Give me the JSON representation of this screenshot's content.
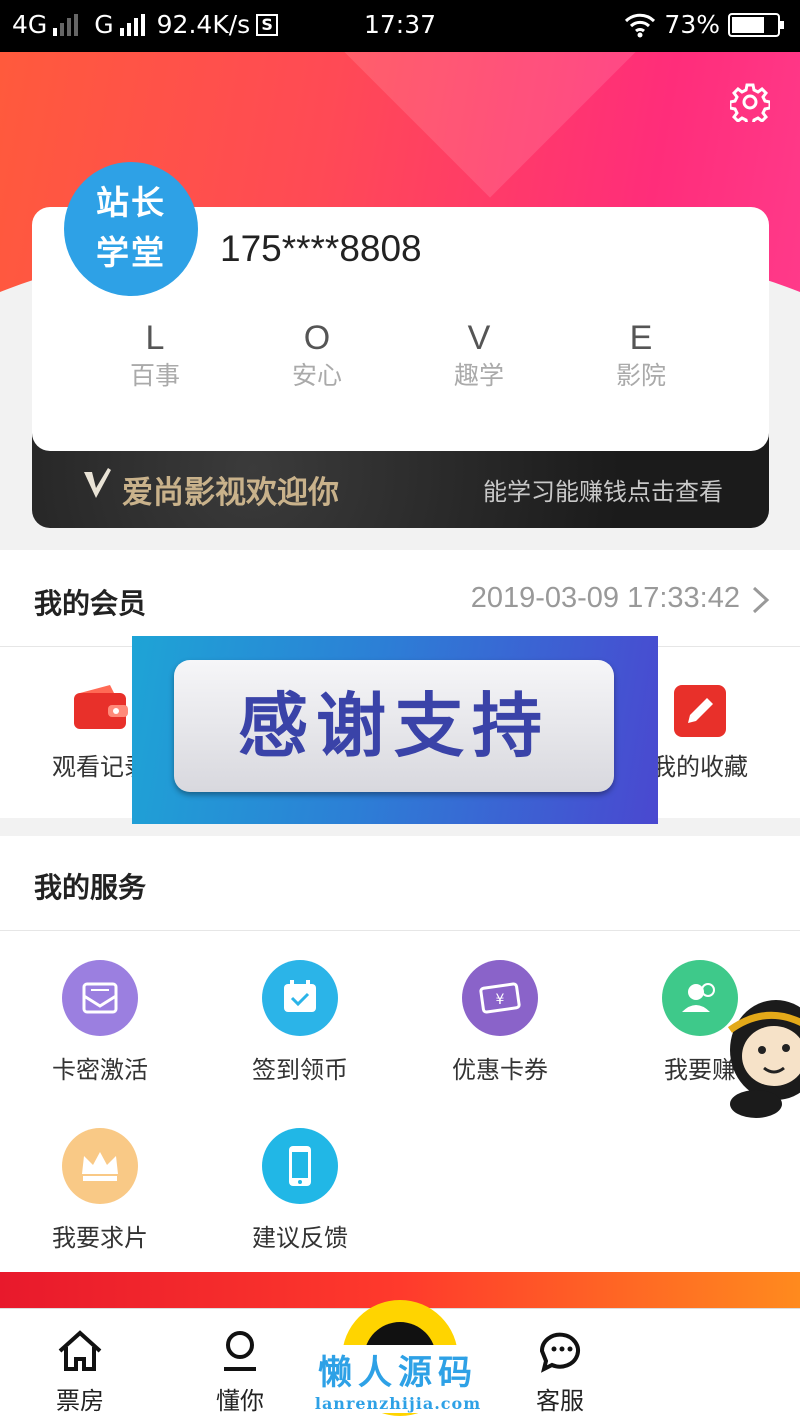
{
  "status_bar": {
    "network1": "4G",
    "network2": "G",
    "speed": "92.4K/s",
    "sim_icon": "S",
    "time": "17:37",
    "battery_percent": "73%",
    "battery_level": 0.73
  },
  "profile": {
    "avatar_line1": "站长",
    "avatar_line2": "学堂",
    "phone": "175****8808",
    "love": [
      {
        "letter": "L",
        "word": "百事"
      },
      {
        "letter": "O",
        "word": "安心"
      },
      {
        "letter": "V",
        "word": "趣学"
      },
      {
        "letter": "E",
        "word": "影院"
      }
    ],
    "slogan": "爱尚影视欢迎你",
    "hint": "能学习能赚钱点击查看"
  },
  "member": {
    "title": "我的会员",
    "date": "2019-03-09 17:33:42",
    "items": [
      {
        "label": "观看记录",
        "icon": "wallet-icon"
      },
      {
        "label": "我的收藏",
        "icon": "edit-icon"
      }
    ]
  },
  "banner_text": "感谢支持",
  "services": {
    "title": "我的服务",
    "items": [
      {
        "label": "卡密激活",
        "icon": "envelope-icon",
        "color": "#9b7fe0"
      },
      {
        "label": "签到领币",
        "icon": "calendar-icon",
        "color": "#2bb4e8"
      },
      {
        "label": "优惠卡券",
        "icon": "coupon-icon",
        "color": "#8a63c9"
      },
      {
        "label": "我要赚",
        "icon": "users-icon",
        "color": "#3ec98a"
      },
      {
        "label": "我要求片",
        "icon": "crown-icon",
        "color": "#f9c986"
      },
      {
        "label": "建议反馈",
        "icon": "phone-icon",
        "color": "#21b7e6"
      }
    ]
  },
  "tabbar": [
    {
      "label": "票房",
      "icon": "home-icon"
    },
    {
      "label": "懂你",
      "icon": "person-icon"
    },
    {
      "label": "客服",
      "icon": "chat-icon"
    }
  ],
  "watermark": {
    "cn": "懒人源码",
    "en": "lanrenzhijia.com"
  }
}
